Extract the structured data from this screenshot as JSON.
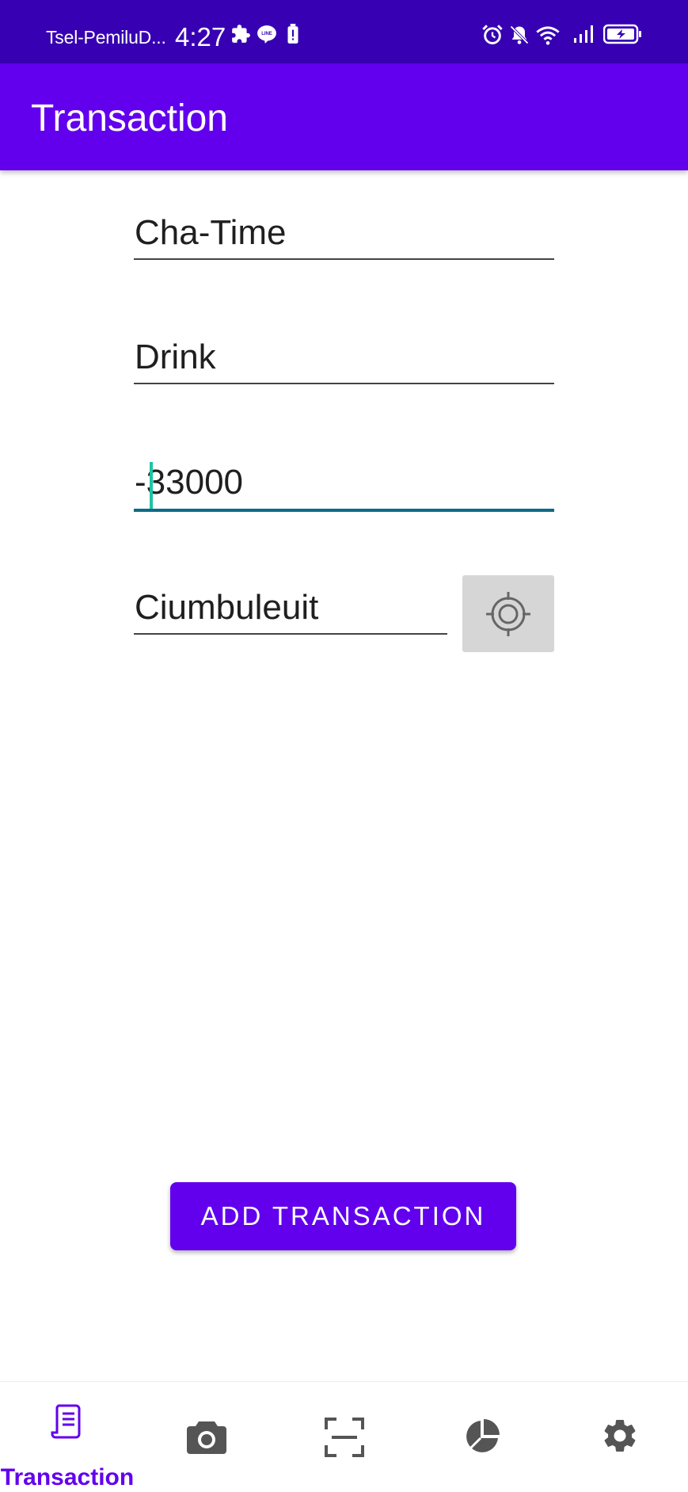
{
  "status_bar": {
    "carrier": "Tsel-PemiluD...",
    "time": "4:27",
    "left_icons": [
      "puzzle-icon",
      "line-chat-icon",
      "battery-alert-icon"
    ],
    "right_icons": [
      "alarm-icon",
      "bell-muted-icon",
      "wifi-icon",
      "signal-icon",
      "battery-charging-icon"
    ]
  },
  "app_bar": {
    "title": "Transaction"
  },
  "form": {
    "name_value": "Cha-Time",
    "category_value": "Drink",
    "amount_value": "-33000",
    "location_value": "Ciumbuleuit",
    "locate_icon": "crosshair-icon"
  },
  "actions": {
    "add_label": "ADD TRANSACTION"
  },
  "bottom_nav": {
    "items": [
      {
        "icon": "receipt-icon",
        "label": "Transaction",
        "active": true
      },
      {
        "icon": "camera-icon",
        "active": false
      },
      {
        "icon": "scan-icon",
        "active": false
      },
      {
        "icon": "pie-chart-icon",
        "active": false
      },
      {
        "icon": "gear-icon",
        "active": false
      }
    ]
  },
  "colors": {
    "primary": "#6200ee",
    "primary_dark": "#3700b3",
    "focus_underline": "#0d6c87",
    "caret": "#1fc3a7",
    "nav_inactive": "#555555"
  }
}
